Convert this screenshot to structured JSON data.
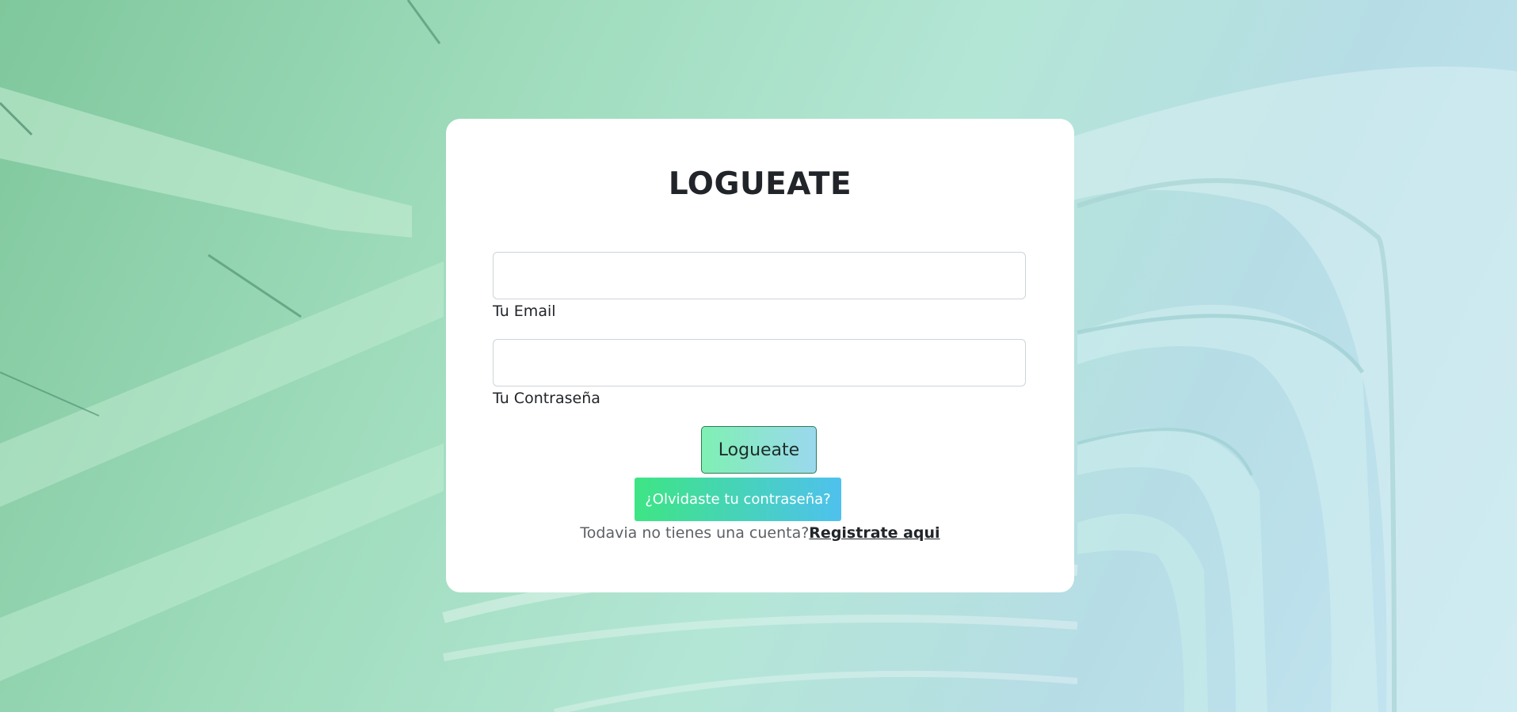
{
  "login": {
    "title": "LOGUEATE",
    "email_label": "Tu Email",
    "password_label": "Tu Contraseña",
    "email_value": "",
    "password_value": "",
    "submit_label": "Logueate",
    "forgot_label": "¿Olvidaste tu contraseña?",
    "signup_prompt": "Todavia no tienes una cuenta?",
    "signup_link": "Registrate aqui"
  },
  "colors": {
    "card_background": "#ffffff",
    "submit_gradient_start": "#7ff0b3",
    "submit_gradient_end": "#9bd8ee",
    "forgot_gradient_start": "#3ee584",
    "forgot_gradient_end": "#4fc1ee",
    "text_dark": "#212529",
    "text_muted": "#5d6166"
  }
}
